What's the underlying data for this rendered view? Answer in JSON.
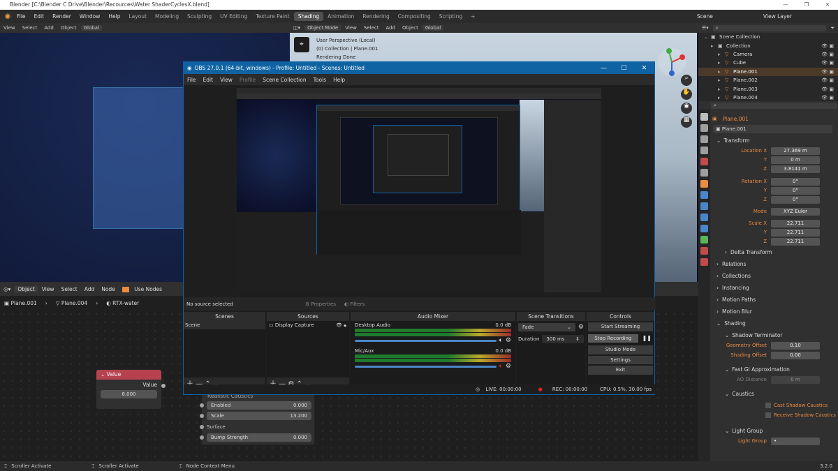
{
  "blender": {
    "window_title": "Blender [C:\\Blender C Drive\\Blender\\Recources\\Water ShaderCyclesX.blend]",
    "menu": [
      "File",
      "Edit",
      "Render",
      "Window",
      "Help"
    ],
    "workspaces": [
      "Layout",
      "Modeling",
      "Sculpting",
      "UV Editing",
      "Texture Paint",
      "Shading",
      "Animation",
      "Rendering",
      "Compositing",
      "Scripting"
    ],
    "active_workspace": "Shading",
    "scene_label": "Scene",
    "view_layer_label": "View Layer",
    "left_toolbar": [
      "View",
      "Select",
      "Add",
      "Object",
      "Global"
    ],
    "right_toolbar": [
      "Object Mode",
      "View",
      "Select",
      "Add",
      "Object",
      "Global"
    ],
    "viewport_info": [
      "User Perspective (Local)",
      "(0) Collection | Plane.001",
      "Rendering Done"
    ],
    "node_header": [
      "Object",
      "View",
      "Select",
      "Add",
      "Node",
      "Use Nodes"
    ],
    "breadcrumb": [
      "Plane.001",
      "Plane.004",
      "RTX-water"
    ],
    "value_node": {
      "title": "Value",
      "output": "Value",
      "value": "8.000"
    },
    "bsdf_node": {
      "header": "Realistic Caustics",
      "rows": [
        {
          "label": "Enabled",
          "value": "0.000"
        },
        {
          "label": "Scale",
          "value": "13.200"
        },
        {
          "label": "Surface",
          "value": ""
        },
        {
          "label": "Bump Strength",
          "value": "0.000"
        }
      ]
    },
    "status": [
      "Scroller Activate",
      "Scroller Activate",
      "Node Context Menu"
    ],
    "version": "3.2.0",
    "outliner": {
      "rows": [
        {
          "name": "Scene Collection",
          "indent": 0
        },
        {
          "name": "Collection",
          "indent": 1
        },
        {
          "name": "Camera",
          "indent": 2
        },
        {
          "name": "Cube",
          "indent": 2
        },
        {
          "name": "Plane.001",
          "indent": 2,
          "selected": true
        },
        {
          "name": "Plane.002",
          "indent": 2
        },
        {
          "name": "Plane.003",
          "indent": 2
        },
        {
          "name": "Plane.004",
          "indent": 2
        }
      ]
    },
    "properties": {
      "object_name": "Plane.001",
      "data_name": "Plane.001",
      "transform_label": "Transform",
      "location": [
        {
          "l": "Location X",
          "v": "27.369 m"
        },
        {
          "l": "Y",
          "v": "0 m"
        },
        {
          "l": "Z",
          "v": "3.8141 m"
        }
      ],
      "rotation": [
        {
          "l": "Rotation X",
          "v": "0°"
        },
        {
          "l": "Y",
          "v": "0°"
        },
        {
          "l": "Z",
          "v": "0°"
        }
      ],
      "mode": {
        "l": "Mode",
        "v": "XYZ Euler"
      },
      "scale": [
        {
          "l": "Scale X",
          "v": "22.711"
        },
        {
          "l": "Y",
          "v": "22.711"
        },
        {
          "l": "Z",
          "v": "22.711"
        }
      ],
      "sections": [
        "Delta Transform",
        "Relations",
        "Collections",
        "Instancing",
        "Motion Paths",
        "Motion Blur",
        "Shading"
      ],
      "shadow_terminator": "Shadow Terminator",
      "geometry_offset": {
        "l": "Geometry Offset",
        "v": "0.10"
      },
      "shading_offset": {
        "l": "Shading Offset",
        "v": "0.00"
      },
      "fast_gi": "Fast GI Approximation",
      "ao_distance": {
        "l": "AO Distance",
        "v": "0 m"
      },
      "caustics": "Caustics",
      "cast_shadow": "Cast Shadow Caustics",
      "receive_shadow": "Receive Shadow Caustics",
      "light_group": "Light Group",
      "light_group_field": "Light Group"
    }
  },
  "obs": {
    "title": "OBS 27.0.1 (64-bit, windows) - Profile: Untitled - Scenes: Untitled",
    "menu": [
      "File",
      "Edit",
      "View",
      "Profile",
      "Scene Collection",
      "Tools",
      "Help"
    ],
    "no_source": "No source selected",
    "properties_label": "Properties",
    "filters_label": "Filters",
    "docks": {
      "scenes": {
        "title": "Scenes",
        "items": [
          "Scene"
        ]
      },
      "sources": {
        "title": "Sources",
        "items": [
          "Display Capture"
        ]
      },
      "mixer": {
        "title": "Audio Mixer",
        "channels": [
          {
            "name": "Desktop Audio",
            "db": "0.0 dB"
          },
          {
            "name": "Mic/Aux",
            "db": "0.0 dB"
          }
        ]
      },
      "transitions": {
        "title": "Scene Transitions",
        "type": "Fade",
        "duration_label": "Duration",
        "duration": "300 ms"
      },
      "controls": {
        "title": "Controls",
        "buttons": [
          "Start Streaming",
          "Stop Recording",
          "Studio Mode",
          "Settings",
          "Exit"
        ]
      }
    },
    "status": {
      "live": "LIVE: 00:00:00",
      "rec": "REC: 00:00:00",
      "cpu": "CPU: 0.5%, 30.00 fps"
    }
  },
  "colors": {
    "accent_orange": "#e98c43",
    "obs_blue": "#0f63a3",
    "node_red": "#b64250"
  }
}
